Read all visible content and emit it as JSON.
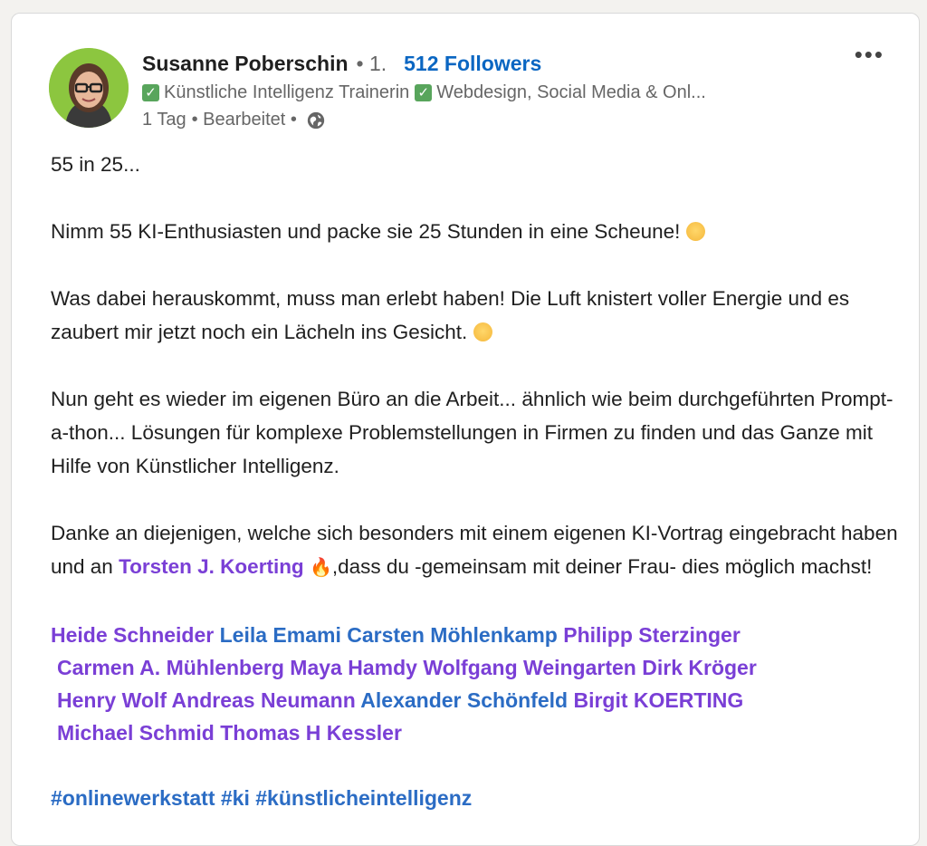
{
  "post": {
    "author": {
      "name": "Susanne Poberschin",
      "degree": "• 1.",
      "followers": "512 Followers",
      "headline_1": "Künstliche Intelligenz Trainerin",
      "headline_2": "Webdesign, Social Media & Onl..."
    },
    "meta": {
      "time": "1 Tag",
      "edited": "• Bearbeitet •"
    },
    "menu_icon": "more-horizontal-icon",
    "body": {
      "p1": "55 in 25...",
      "p2": "Nimm 55 KI-Enthusiasten und packe sie 25 Stunden in eine Scheune!",
      "p3": "Was dabei herauskommt, muss man erlebt haben! Die Luft knistert voller Energie und es zaubert mir jetzt noch ein Lächeln ins Gesicht.",
      "p4": "Nun geht es wieder im eigenen Büro an die Arbeit... ähnlich wie beim durchgeführten Prompt-a-thon... Lösungen für komplexe Problemstellungen in Firmen zu finden und das Ganze mit Hilfe von Künstlicher Intelligenz.",
      "p5_a": "Danke an diejenigen, welche sich besonders mit einem eigenen KI-Vortrag eingebracht haben und an ",
      "p5_mention": "Torsten J. Koerting",
      "p5_b": ",dass du -gemeinsam mit deiner Frau- dies möglich machst!"
    },
    "mentions": [
      "Heide Schneider",
      "Leila Emami",
      "Carsten Möhlenkamp",
      "Philipp Sterzinger",
      "Carmen A. Mühlenberg",
      "Maya Hamdy",
      "Wolfgang Weingarten",
      "Dirk Kröger",
      "Henry Wolf",
      "Andreas Neumann",
      "Alexander Schönfeld",
      "Birgit KOERTING",
      "Michael Schmid",
      "Thomas H Kessler"
    ],
    "hashtags": [
      "#onlinewerkstatt",
      "#ki",
      "#künstlicheintelligenz"
    ],
    "colors": {
      "mention_purple": "#7a3fd6",
      "mention_blue": "#2b6cc4",
      "followers_blue": "#0a66c2"
    }
  }
}
